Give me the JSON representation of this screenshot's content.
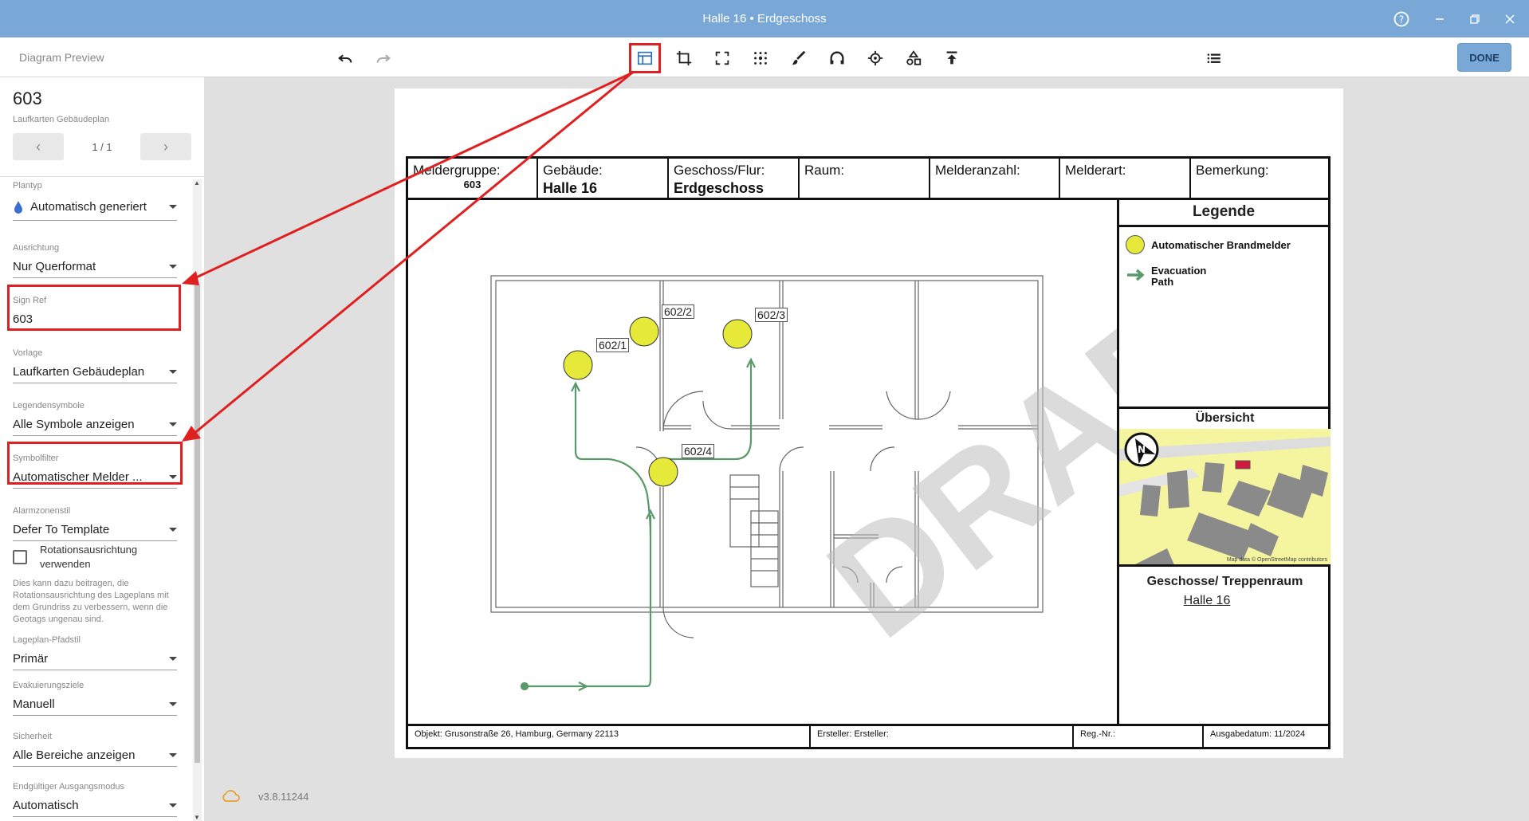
{
  "window": {
    "title": "Halle 16 • Erdgeschoss"
  },
  "toolbar": {
    "crumb": "Diagram Preview",
    "done_label": "DONE"
  },
  "panel": {
    "sign_number": "603",
    "template_sub": "Laufkarten Gebäudeplan",
    "pager": "1 / 1",
    "fields": [
      {
        "label": "Plantyp",
        "value": "Automatisch generiert"
      },
      {
        "label": "Ausrichtung",
        "value": "Nur Querformat"
      },
      {
        "label": "Sign Ref",
        "value": "603"
      },
      {
        "label": "Vorlage",
        "value": "Laufkarten Gebäudeplan"
      },
      {
        "label": "Legendensymbole",
        "value": "Alle Symbole anzeigen"
      },
      {
        "label": "Symbolfilter",
        "value": "Automatischer Melder ..."
      },
      {
        "label": "Alarmzonenstil",
        "value": "Defer To Template"
      },
      {
        "label": "Lageplan-Pfadstil",
        "value": "Primär"
      },
      {
        "label": "Evakuierungsziele",
        "value": "Manuell"
      },
      {
        "label": "Sicherheit",
        "value": "Alle Bereiche anzeigen"
      },
      {
        "label": "Endgültiger Ausgangsmodus",
        "value": "Automatisch"
      }
    ],
    "checkbox_label": "Rotationsausrichtung verwenden",
    "note": "Dies kann dazu beitragen, die Rotationsausrichtung des Lageplans mit dem Grundriss zu verbessern, wenn die Geotags ungenau sind."
  },
  "version": "v3.8.11244",
  "plan": {
    "header": [
      {
        "label": "Meldergruppe:",
        "value": "603"
      },
      {
        "label": "Gebäude:",
        "value": "Halle 16"
      },
      {
        "label": "Geschoss/Flur:",
        "value": "Erdgeschoss"
      },
      {
        "label": "Raum:",
        "value": ""
      },
      {
        "label": "Melderanzahl:",
        "value": ""
      },
      {
        "label": "Melderart:",
        "value": ""
      },
      {
        "label": "Bemerkung:",
        "value": ""
      }
    ],
    "legend_title": "Legende",
    "legend_detector": "Automatischer Brandmelder",
    "legend_evac_1": "Evacuation",
    "legend_evac_2": "Path",
    "overview_title": "Übersicht",
    "map_credit": "Map data © OpenStreetMap contributors",
    "floor_title": "Geschosse/ Treppenraum",
    "floor_link": "Halle 16",
    "rooms": [
      "602/1",
      "602/2",
      "602/3",
      "602/4"
    ],
    "watermark": "DRAFT",
    "footer": {
      "objekt": "Objekt:  Grusonstraße 26, Hamburg, Germany 22113",
      "ersteller": "Ersteller: Ersteller:",
      "regnr": "Reg.-Nr.:",
      "ausgabe": "Ausgabedatum: 11/2024"
    }
  },
  "colors": {
    "accent": "#7aa8d6",
    "highlight": "#e02020",
    "detector": "#e6e83a",
    "path": "#5a9a6a"
  }
}
